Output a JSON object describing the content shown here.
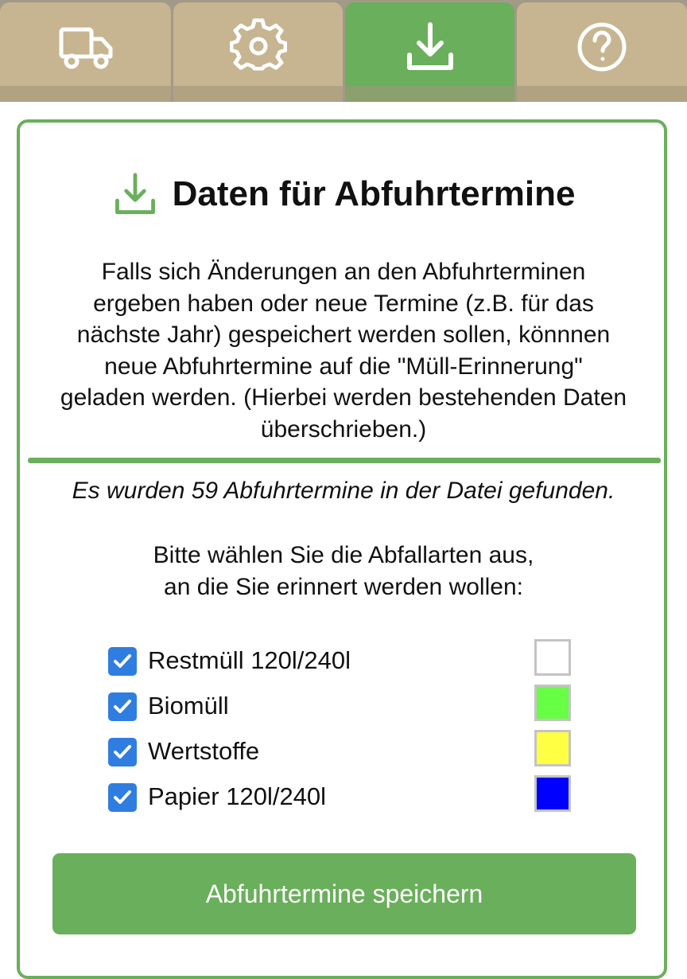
{
  "tabs": [
    {
      "icon": "truck-icon",
      "active": false
    },
    {
      "icon": "gear-icon",
      "active": false
    },
    {
      "icon": "download-icon",
      "active": true
    },
    {
      "icon": "help-icon",
      "active": false
    }
  ],
  "panel": {
    "title": "Daten für Abfuhrtermine",
    "title_icon": "download-icon",
    "intro_lines": [
      "Falls sich Änderungen an den Abfuhrterminen",
      "ergeben haben oder neue Termine (z.B. für das",
      "nächste Jahr) gespeichert werden sollen, könnnen",
      "neue Abfuhrtermine auf die \"Müll-Erinnerung\"",
      "geladen werden. (Hierbei werden bestehenden Daten",
      "überschrieben.)"
    ],
    "found_text": "Es wurden 59 Abfuhrtermine in der Datei gefunden.",
    "prompt_lines": [
      "Bitte wählen Sie die Abfallarten aus,",
      "an die Sie erinnert werden wollen:"
    ],
    "waste_types": [
      {
        "label": "Restmüll 120l/240l",
        "checked": true,
        "color": "#ffffff"
      },
      {
        "label": "Biomüll",
        "checked": true,
        "color": "#66ff44"
      },
      {
        "label": "Wertstoffe",
        "checked": true,
        "color": "#ffff44"
      },
      {
        "label": "Papier 120l/240l",
        "checked": true,
        "color": "#0000ff"
      }
    ],
    "save_button": "Abfuhrtermine speichern"
  },
  "colors": {
    "accent": "#6aaf5b",
    "tab_bg": "#c6b590",
    "checkbox": "#2f7de1"
  }
}
